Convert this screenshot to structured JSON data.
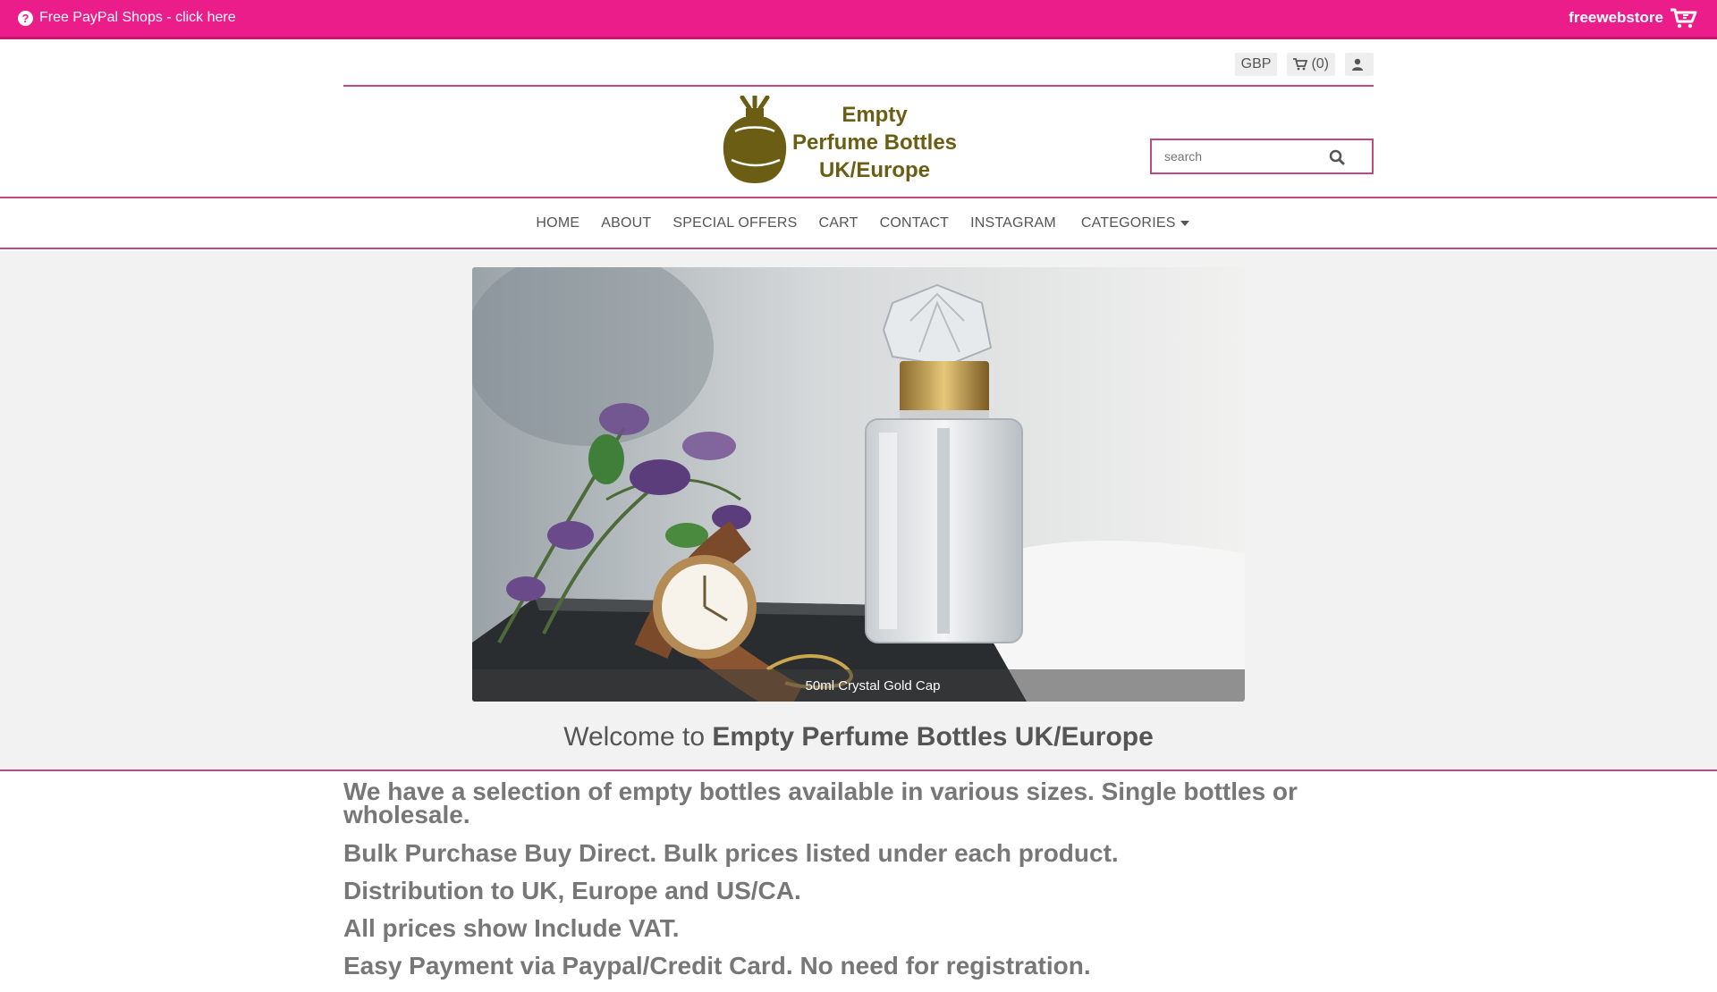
{
  "topbar": {
    "promo_text": "Free PayPal Shops - click here",
    "brand": "freewebstore",
    "bg_color": "#ea1d8a"
  },
  "utility": {
    "currency": "GBP",
    "cart_count": "(0)",
    "icons": [
      "cart-icon",
      "user-icon"
    ]
  },
  "header": {
    "logo_lines": [
      "Empty",
      "Perfume Bottles",
      "UK/Europe"
    ],
    "search_placeholder": "search"
  },
  "nav": {
    "items": [
      "HOME",
      "ABOUT",
      "SPECIAL OFFERS",
      "CART",
      "CONTACT",
      "INSTAGRAM",
      "CATEGORIES"
    ]
  },
  "slider": {
    "caption": "50ml Crystal Gold Cap"
  },
  "welcome": {
    "prefix": "Welcome to",
    "store_name": "Empty Perfume Bottles UK/Europe"
  },
  "content": {
    "lines": [
      "We have a selection of empty bottles available in various sizes.  Single bottles or wholesale.",
      "Bulk Purchase Buy Direct. Bulk prices listed under each product.",
      "Distribution to UK, Europe and US/CA.",
      "All prices show Include VAT.",
      "Easy Payment via Paypal/Credit Card. No need for registration."
    ]
  },
  "colors": {
    "accent": "#ea1d8a",
    "divider": "#c04a7f",
    "logo_olive": "#6b5e14"
  }
}
